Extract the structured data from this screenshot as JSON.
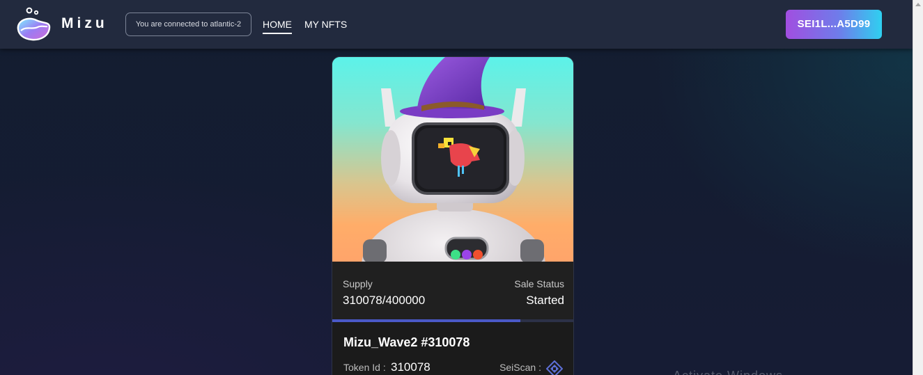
{
  "header": {
    "brand": "Mizu",
    "network_badge": "You are connected to atlantic-2",
    "nav": {
      "home": "HOME",
      "my_nfts": "MY NFTS"
    },
    "wallet_button": "SEI1L...A5D99",
    "icons": {
      "logo": "mizu-water-drop-logo"
    }
  },
  "nft_card": {
    "image": "robot-wizard-nft-image",
    "supply_label": "Supply",
    "supply_value": "310078/400000",
    "sale_status_label": "Sale Status",
    "sale_status_value": "Started",
    "progress_fraction": 0.775,
    "title": "Mizu_Wave2 #310078",
    "token_id_label": "Token Id :",
    "token_id_value": "310078",
    "seiscan_label": "SeiScan :",
    "icons": {
      "seiscan": "seiscan-diamond-icon"
    }
  },
  "background_text": "Activate Windows",
  "colors": {
    "header_bg": "#222a3e",
    "page_bg": "#131c2e",
    "wallet_gradient_start": "#a14ee0",
    "wallet_gradient_end": "#2fd0f0",
    "progress_fill": "#4a59c7"
  }
}
